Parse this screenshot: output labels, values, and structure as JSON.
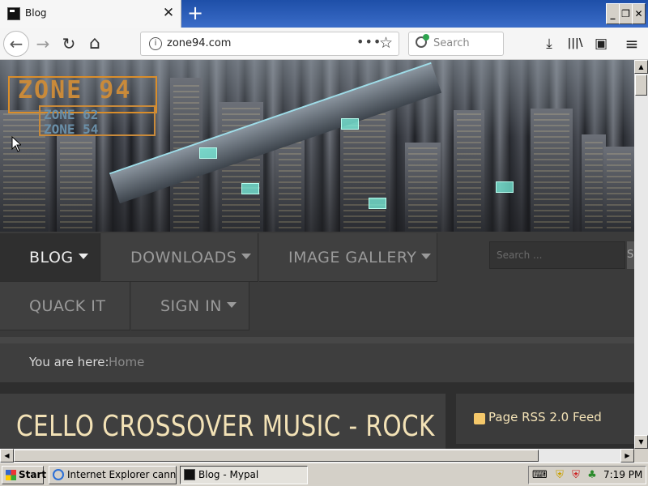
{
  "browser": {
    "tab": {
      "title": "Blog",
      "close": "✕"
    },
    "new_tab": "+",
    "window_controls": {
      "minimize": "_",
      "restore": "❐",
      "close": "✕"
    },
    "nav": {
      "back": "←",
      "forward": "→",
      "reload": "↻",
      "home": "⌂"
    },
    "url": "zone94.com",
    "page_actions": "•••",
    "star": "☆",
    "search_placeholder": "Search",
    "toolbar": {
      "downloads": "⤓",
      "library": "|||\\",
      "sidebar": "▣",
      "menu": "≡"
    }
  },
  "site": {
    "logo": {
      "main": "ZONE 94",
      "sub1": "ZONE 62",
      "sub2": "ZONE 54"
    },
    "menu": [
      {
        "label": "BLOG",
        "dropdown": true,
        "active": true
      },
      {
        "label": "DOWNLOADS",
        "dropdown": true,
        "active": false
      },
      {
        "label": "IMAGE GALLERY",
        "dropdown": true,
        "active": false
      },
      {
        "label": "QUACK IT",
        "dropdown": false,
        "active": false
      },
      {
        "label": "SIGN IN",
        "dropdown": true,
        "active": false
      }
    ],
    "search_placeholder": "Search ...",
    "search_button": "S",
    "breadcrumb": {
      "label": "You are here:",
      "home": "Home"
    },
    "article_title": "CELLO CROSSOVER MUSIC - ROCK",
    "rss_label": "Page RSS 2.0 Feed"
  },
  "taskbar": {
    "start": "Start",
    "tasks": [
      {
        "label": "Internet Explorer cannot...",
        "active": false
      },
      {
        "label": "Blog - Mypal",
        "active": true
      }
    ],
    "clock": "7:19 PM"
  },
  "colors": {
    "title_accent": "#f3e2b6",
    "logo_orange": "#c98a3a",
    "nav_bg": "#404040",
    "tab_strip_blue": "#2a5bb8"
  }
}
